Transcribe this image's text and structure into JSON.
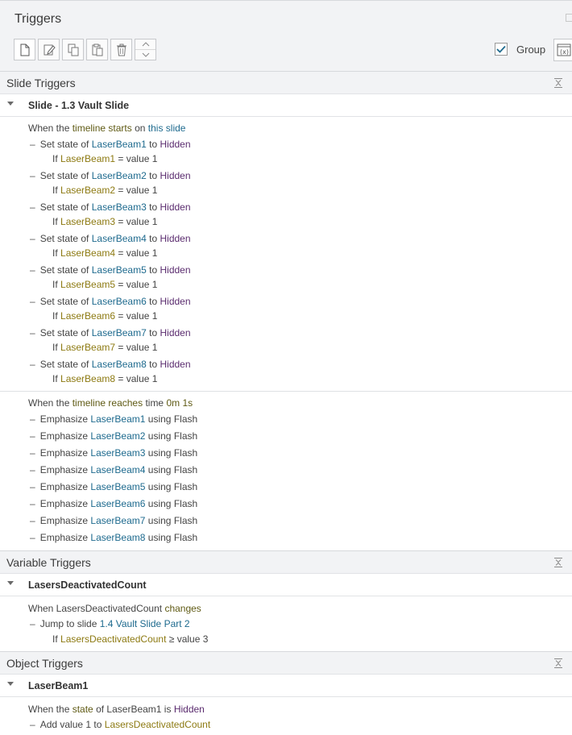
{
  "panel": {
    "title": "Triggers",
    "group_label": "Group",
    "group_checked": true
  },
  "toolbar": {
    "buttons": [
      "new-trigger",
      "edit-trigger",
      "copy-trigger",
      "paste-trigger",
      "delete-trigger",
      "move-up-down"
    ]
  },
  "slide_triggers": {
    "header": "Slide Triggers",
    "group": "Slide - 1.3 Vault Slide",
    "event1": {
      "w1": "When the",
      "k1": "timeline starts",
      "w2": "on",
      "k2": "this slide"
    },
    "set_state_items": [
      {
        "set": "Set state of",
        "obj": "LaserBeam1",
        "to": "to",
        "state": "Hidden",
        "if": "If",
        "cond_obj": "LaserBeam1",
        "cond_rest": "= value 1"
      },
      {
        "set": "Set state of",
        "obj": "LaserBeam2",
        "to": "to",
        "state": "Hidden",
        "if": "If",
        "cond_obj": "LaserBeam2",
        "cond_rest": "= value 1"
      },
      {
        "set": "Set state of",
        "obj": "LaserBeam3",
        "to": "to",
        "state": "Hidden",
        "if": "If",
        "cond_obj": "LaserBeam3",
        "cond_rest": "= value 1"
      },
      {
        "set": "Set state of",
        "obj": "LaserBeam4",
        "to": "to",
        "state": "Hidden",
        "if": "If",
        "cond_obj": "LaserBeam4",
        "cond_rest": "= value 1"
      },
      {
        "set": "Set state of",
        "obj": "LaserBeam5",
        "to": "to",
        "state": "Hidden",
        "if": "If",
        "cond_obj": "LaserBeam5",
        "cond_rest": "= value 1"
      },
      {
        "set": "Set state of",
        "obj": "LaserBeam6",
        "to": "to",
        "state": "Hidden",
        "if": "If",
        "cond_obj": "LaserBeam6",
        "cond_rest": "= value 1"
      },
      {
        "set": "Set state of",
        "obj": "LaserBeam7",
        "to": "to",
        "state": "Hidden",
        "if": "If",
        "cond_obj": "LaserBeam7",
        "cond_rest": "= value 1"
      },
      {
        "set": "Set state of",
        "obj": "LaserBeam8",
        "to": "to",
        "state": "Hidden",
        "if": "If",
        "cond_obj": "LaserBeam8",
        "cond_rest": "= value 1"
      }
    ],
    "event2": {
      "w1": "When the",
      "k1": "timeline reaches",
      "w2": "time",
      "k2": "0m 1s"
    },
    "emphasize_items": [
      {
        "pre": "Emphasize",
        "obj": "LaserBeam1",
        "post": "using Flash"
      },
      {
        "pre": "Emphasize",
        "obj": "LaserBeam2",
        "post": "using Flash"
      },
      {
        "pre": "Emphasize",
        "obj": "LaserBeam3",
        "post": "using Flash"
      },
      {
        "pre": "Emphasize",
        "obj": "LaserBeam4",
        "post": "using Flash"
      },
      {
        "pre": "Emphasize",
        "obj": "LaserBeam5",
        "post": "using Flash"
      },
      {
        "pre": "Emphasize",
        "obj": "LaserBeam6",
        "post": "using Flash"
      },
      {
        "pre": "Emphasize",
        "obj": "LaserBeam7",
        "post": "using Flash"
      },
      {
        "pre": "Emphasize",
        "obj": "LaserBeam8",
        "post": "using Flash"
      }
    ]
  },
  "variable_triggers": {
    "header": "Variable Triggers",
    "group": "LasersDeactivatedCount",
    "event": {
      "w1": "When LasersDeactivatedCount",
      "k1": "changes"
    },
    "action": {
      "pre": "Jump to slide",
      "target": "1.4 Vault Slide Part 2"
    },
    "cond": {
      "if": "If",
      "obj": "LasersDeactivatedCount",
      "rest": "≥ value 3"
    }
  },
  "object_triggers": {
    "header": "Object Triggers",
    "group": "LaserBeam1",
    "event": {
      "w1": "When the",
      "k1": "state",
      "w2": "of LaserBeam1 is",
      "k2": "Hidden"
    },
    "action": {
      "pre": "Add value 1 to",
      "target": "LasersDeactivatedCount"
    }
  },
  "colors": {
    "header_bg": "#f2f3f5",
    "olive": "#5f5a14",
    "blue": "#1e6a8e",
    "purple": "#5a2b6e",
    "gold": "#8d7a12",
    "checkbox": "#1e6a8e"
  }
}
